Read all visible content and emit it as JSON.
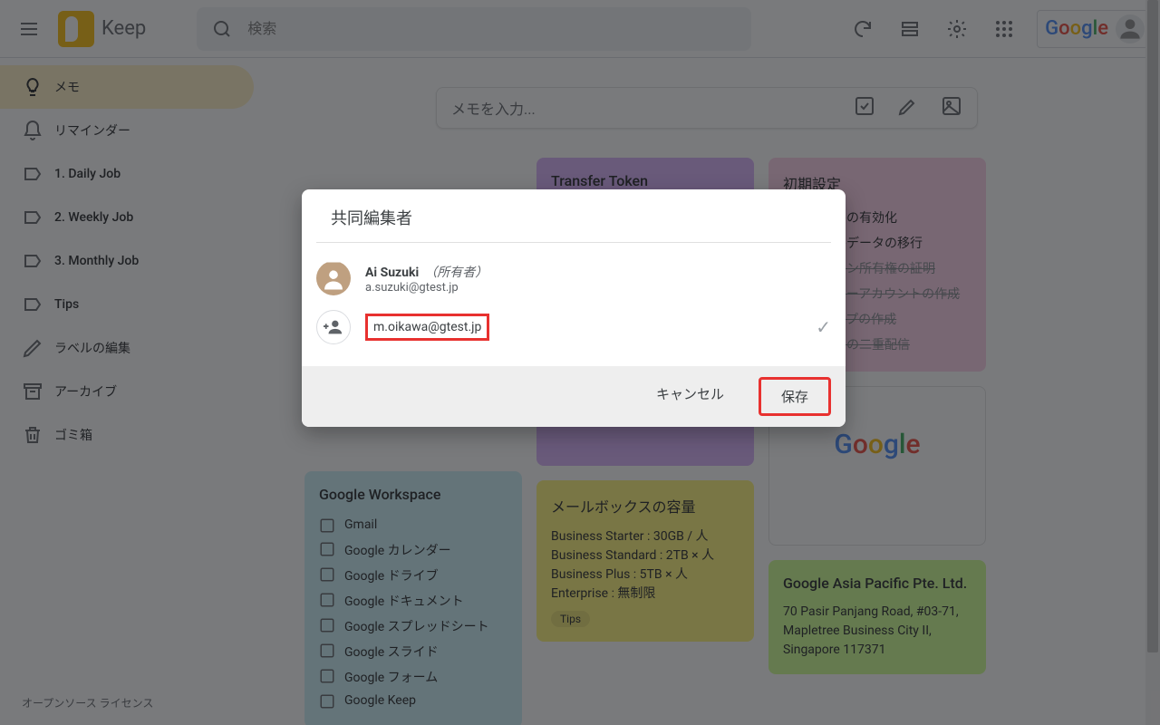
{
  "header": {
    "app_name": "Keep",
    "search_placeholder": "検索"
  },
  "sidebar": {
    "items": [
      {
        "label": "メモ",
        "icon": "bulb",
        "active": true
      },
      {
        "label": "リマインダー",
        "icon": "bell"
      },
      {
        "label": "1. Daily Job",
        "icon": "label"
      },
      {
        "label": "2. Weekly Job",
        "icon": "label"
      },
      {
        "label": "3. Monthly Job",
        "icon": "label"
      },
      {
        "label": "Tips",
        "icon": "label"
      },
      {
        "label": "ラベルの編集",
        "icon": "pencil"
      },
      {
        "label": "アーカイブ",
        "icon": "archive"
      },
      {
        "label": "ゴミ箱",
        "icon": "trash"
      }
    ],
    "oss": "オープンソース ライセンス"
  },
  "take_note": {
    "placeholder": "メモを入力..."
  },
  "notes": {
    "workspace": {
      "title": "Google Workspace",
      "items": [
        "Gmail",
        "Google カレンダー",
        "Google ドライブ",
        "Google ドキュメント",
        "Google スプレッドシート",
        "Google スライド",
        "Google フォーム",
        "Google Keep"
      ]
    },
    "transfer": {
      "title": "Transfer Token"
    },
    "setup": {
      "title": "初期設定",
      "open": [
        "メールの有効化",
        "メールデータの移行"
      ],
      "done": [
        "ドメイン所有権の証明",
        "ユーザーアカウントの作成",
        "グループの作成",
        "メールの二重配信"
      ]
    },
    "mailbox": {
      "title": "メールボックスの容量",
      "lines": [
        "Business Starter : 30GB / 人",
        "Business Standard : 2TB × 人",
        "Business Plus : 5TB × 人",
        "Enterprise : 無制限"
      ],
      "chip": "Tips"
    },
    "addr": {
      "title": "Google Asia Pacific Pte. Ltd.",
      "lines": [
        "70 Pasir Panjang Road, #03-71,",
        "Mapletree Business City II,",
        "Singapore 117371"
      ]
    }
  },
  "dialog": {
    "title": "共同編集者",
    "owner_name": "Ai Suzuki",
    "owner_tag": "（所有者）",
    "owner_email": "a.suzuki@gtest.jp",
    "input_value": "m.oikawa@gtest.jp",
    "cancel": "キャンセル",
    "save": "保存"
  }
}
